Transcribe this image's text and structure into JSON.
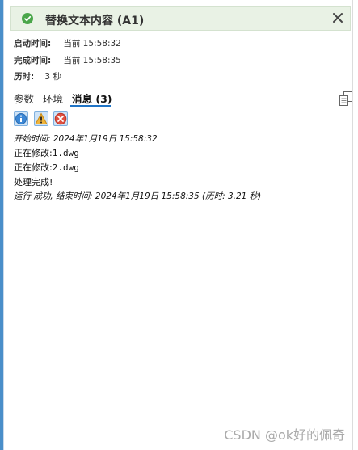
{
  "header": {
    "title": "替换文本内容 (A1)",
    "status_icon": "check-circle-icon",
    "close_icon": "close-icon",
    "colors": {
      "success": "#4aa64a",
      "header_bg": "#e9f2e5",
      "accent": "#1f74c6"
    }
  },
  "info": {
    "start_label": "启动时间:",
    "start_value": "当前 15:58:32",
    "finish_label": "完成时间:",
    "finish_value": "当前 15:58:35",
    "duration_label": "历时:",
    "duration_value": "3 秒"
  },
  "tabs": [
    {
      "label": "参数"
    },
    {
      "label": "环境"
    },
    {
      "label": "消息 (3)",
      "active": true
    }
  ],
  "filters": [
    {
      "icon": "info-icon",
      "active": true
    },
    {
      "icon": "warning-icon",
      "active": true
    },
    {
      "icon": "error-icon",
      "active": true
    }
  ],
  "messages": {
    "start": "开始时间: 2024年1月19日 15:58:32",
    "m1_prefix": "正在修改:",
    "m1_file": "1.dwg",
    "m2_prefix": "正在修改:",
    "m2_file": "2.dwg",
    "done": "处理完成!",
    "end": "运行 成功, 结束时间: 2024年1月19日 15:58:35 (历时: 3.21 秒)"
  },
  "watermark": "CSDN @ok好的佩奇"
}
